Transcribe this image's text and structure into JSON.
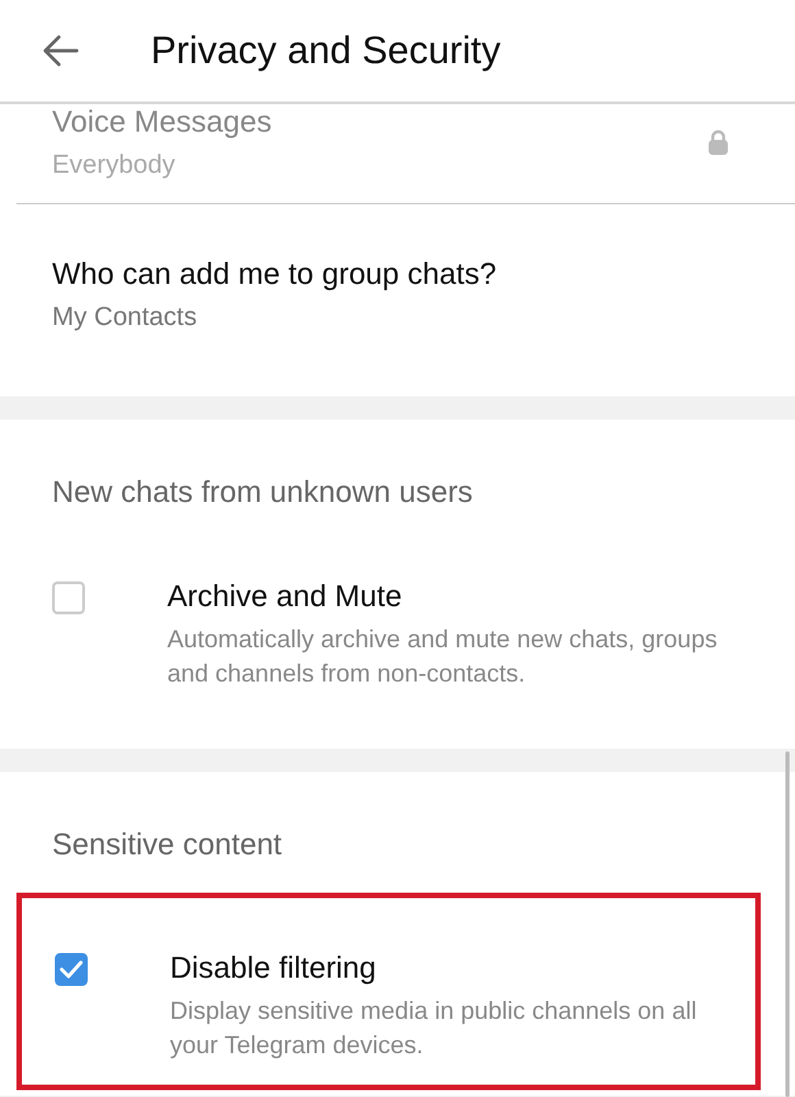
{
  "header": {
    "title": "Privacy and Security"
  },
  "rows": [
    {
      "title": "Voice Messages",
      "value": "Everybody",
      "locked": true
    },
    {
      "title": "Who can add me to group chats?",
      "value": "My Contacts",
      "locked": false
    }
  ],
  "sections": [
    {
      "heading": "New chats from unknown users",
      "highlighted": false,
      "option": {
        "title": "Archive and Mute",
        "description": "Automatically archive and mute new chats, groups and channels from non-contacts.",
        "checked": false
      }
    },
    {
      "heading": "Sensitive content",
      "highlighted": true,
      "option": {
        "title": "Disable filtering",
        "description": "Display sensitive media in public channels on all your Telegram devices.",
        "checked": true
      }
    }
  ]
}
